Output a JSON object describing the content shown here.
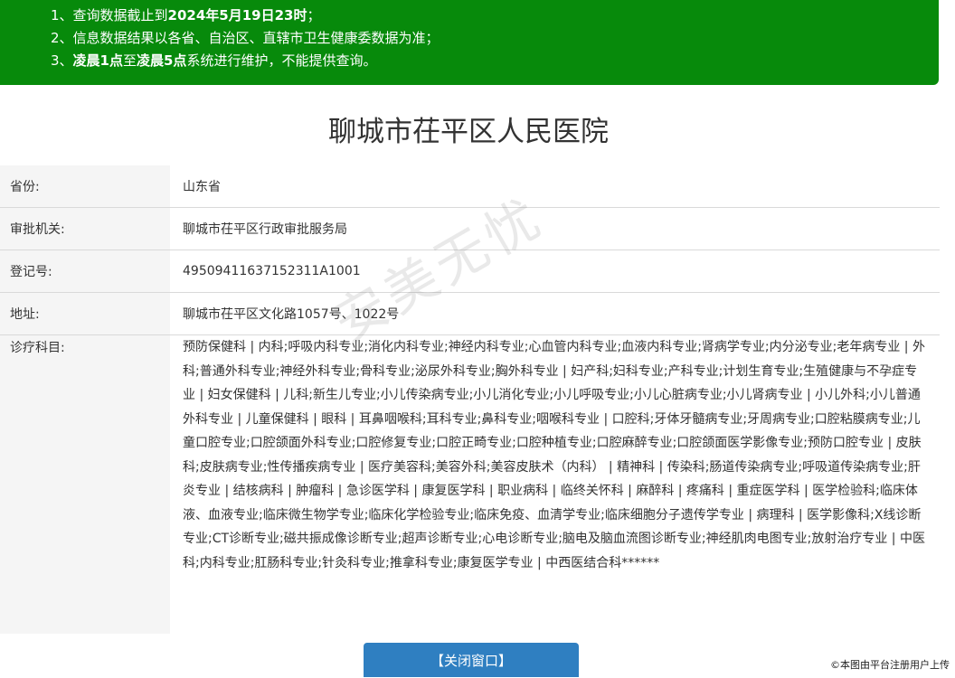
{
  "notice": {
    "line1_prefix": "1、查询数据截止到",
    "line1_bold": "2024年5月19日23时",
    "line1_suffix": "；",
    "line2": "2、信息数据结果以各省、自治区、直辖市卫生健康委数据为准；",
    "line3_prefix": "3、",
    "line3_bold1": "凌晨1点",
    "line3_mid": "至",
    "line3_bold2": "凌晨5点",
    "line3_suffix": "系统进行维护，不能提供查询。"
  },
  "hospital": {
    "title": "聊城市茌平区人民医院"
  },
  "fields": [
    {
      "label": "省份:",
      "value": "山东省"
    },
    {
      "label": "审批机关:",
      "value": "聊城市茌平区行政审批服务局"
    },
    {
      "label": "登记号:",
      "value": "49509411637152311A1001"
    },
    {
      "label": "地址:",
      "value": "聊城市茌平区文化路1057号、1022号"
    },
    {
      "label": "诊疗科目:",
      "value": "预防保健科 | 内科;呼吸内科专业;消化内科专业;神经内科专业;心血管内科专业;血液内科专业;肾病学专业;内分泌专业;老年病专业 | 外科;普通外科专业;神经外科专业;骨科专业;泌尿外科专业;胸外科专业 | 妇产科;妇科专业;产科专业;计划生育专业;生殖健康与不孕症专业 | 妇女保健科 | 儿科;新生儿专业;小儿传染病专业;小儿消化专业;小儿呼吸专业;小儿心脏病专业;小儿肾病专业 | 小儿外科;小儿普通外科专业 | 儿童保健科 | 眼科 | 耳鼻咽喉科;耳科专业;鼻科专业;咽喉科专业 | 口腔科;牙体牙髓病专业;牙周病专业;口腔粘膜病专业;儿童口腔专业;口腔颌面外科专业;口腔修复专业;口腔正畸专业;口腔种植专业;口腔麻醉专业;口腔颌面医学影像专业;预防口腔专业 | 皮肤科;皮肤病专业;性传播疾病专业 | 医疗美容科;美容外科;美容皮肤术（内科） | 精神科 | 传染科;肠道传染病专业;呼吸道传染病专业;肝炎专业 | 结核病科 | 肿瘤科 | 急诊医学科 | 康复医学科 | 职业病科 | 临终关怀科 | 麻醉科 | 疼痛科 | 重症医学科 | 医学检验科;临床体液、血液专业;临床微生物学专业;临床化学检验专业;临床免疫、血清学专业;临床细胞分子遗传学专业 | 病理科 | 医学影像科;X线诊断专业;CT诊断专业;磁共振成像诊断专业;超声诊断专业;心电诊断专业;脑电及脑血流图诊断专业;神经肌肉电图专业;放射治疗专业 | 中医科;内科专业;肛肠科专业;针灸科专业;推拿科专业;康复医学专业 | 中西医结合科******"
    }
  ],
  "buttons": {
    "close": "【关闭窗口】"
  },
  "footer": {
    "copyright": "©本图由平台注册用户上传"
  },
  "watermark": "安美无忧",
  "colors": {
    "notice_bg": "#078a0b",
    "button_bg": "#2f7fc1",
    "label_bg": "#f5f5f5"
  }
}
